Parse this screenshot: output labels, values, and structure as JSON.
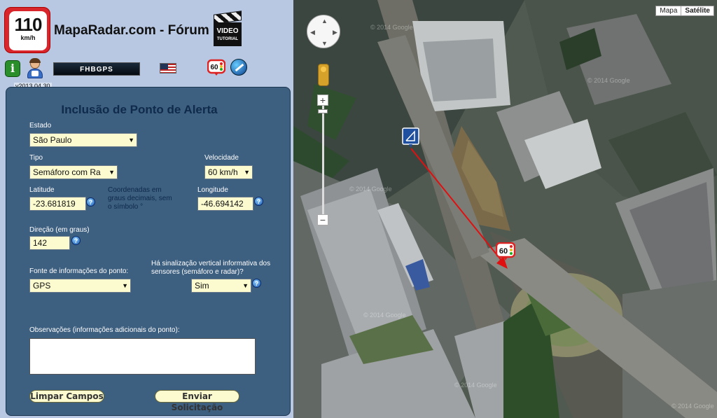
{
  "header": {
    "logo_number": "110",
    "logo_unit": "km/h",
    "site_title": "MapaRadar.com - Fórum",
    "video_line1": "VIDEO",
    "video_line2": "TUTORIAL",
    "version": "v2013.04.30",
    "gps_badge": "FHBGPS",
    "radar_speed": "60"
  },
  "form": {
    "title": "Inclusão de Ponto de Alerta",
    "estado": {
      "label": "Estado",
      "value": "São Paulo"
    },
    "tipo": {
      "label": "Tipo",
      "value": "Semáforo com Ra"
    },
    "velocidade": {
      "label": "Velocidade",
      "value": "60 km/h"
    },
    "latitude": {
      "label": "Latitude",
      "value": "-23.681819"
    },
    "coord_hint": "Coordenadas em graus decimais, sem o símbolo °",
    "longitude": {
      "label": "Longitude",
      "value": "-46.694142"
    },
    "direcao": {
      "label": "Direção (em graus)",
      "value": "142"
    },
    "fonte": {
      "label": "Fonte de informações do ponto:",
      "value": "GPS"
    },
    "sinalizacao": {
      "label": "Há sinalização vertical informativa dos sensores (semáforo e radar)?",
      "value": "Sim"
    },
    "observacoes": {
      "label": "Observações (informações adicionais do ponto):",
      "value": ""
    },
    "buttons": {
      "clear": "Limpar Campos",
      "submit": "Enviar Solicitação"
    }
  },
  "map": {
    "type_buttons": {
      "map": "Mapa",
      "satellite": "Satélite",
      "selected": "Satélite"
    },
    "zoom_in": "+",
    "zoom_out": "−",
    "radar_marker_speed": "60",
    "watermark": "© 2014 Google"
  }
}
